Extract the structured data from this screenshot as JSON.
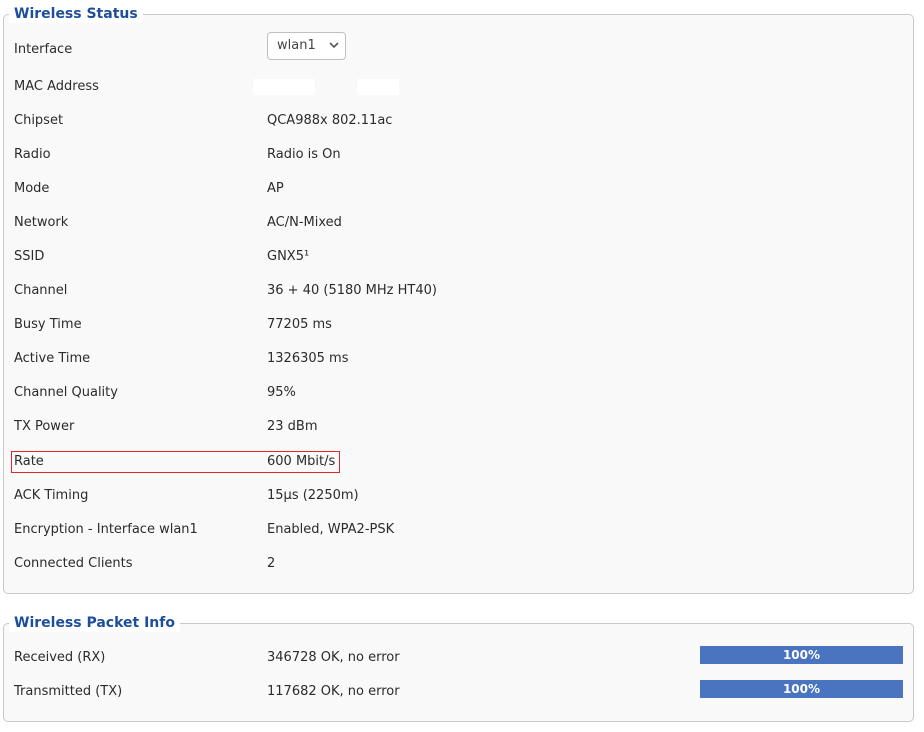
{
  "wireless_status": {
    "title": "Wireless Status",
    "interface": {
      "label": "Interface",
      "selected": "wlan1"
    },
    "mac_address": {
      "label": "MAC Address"
    },
    "chipset": {
      "label": "Chipset",
      "value": "QCA988x 802.11ac"
    },
    "radio": {
      "label": "Radio",
      "value": "Radio is On"
    },
    "mode": {
      "label": "Mode",
      "value": "AP"
    },
    "network": {
      "label": "Network",
      "value": "AC/N-Mixed"
    },
    "ssid": {
      "label": "SSID",
      "value": "GNX5¹"
    },
    "channel": {
      "label": "Channel",
      "value": "36 + 40 (5180 MHz HT40)"
    },
    "busy_time": {
      "label": "Busy Time",
      "value": "77205 ms"
    },
    "active_time": {
      "label": "Active Time",
      "value": "1326305 ms"
    },
    "channel_quality": {
      "label": "Channel Quality",
      "value": "95%"
    },
    "tx_power": {
      "label": "TX Power",
      "value": "23 dBm"
    },
    "rate": {
      "label": "Rate",
      "value": "600 Mbit/s"
    },
    "ack_timing": {
      "label": "ACK Timing",
      "value": "15μs (2250m)"
    },
    "encryption": {
      "label": "Encryption - Interface wlan1",
      "value": "Enabled, WPA2-PSK"
    },
    "connected_clients": {
      "label": "Connected Clients",
      "value": "2"
    }
  },
  "packet_info": {
    "title": "Wireless Packet Info",
    "rx": {
      "label": "Received (RX)",
      "value": "346728 OK, no error",
      "bar_text": "100%",
      "fill_fraction": 1.0
    },
    "tx": {
      "label": "Transmitted (TX)",
      "value": "117682 OK, no error",
      "bar_text": "100%",
      "fill_fraction": 1.0
    }
  },
  "colors": {
    "legend_title": "#1d4e9a",
    "bar_fill": "#4a73c0",
    "highlight_border": "#d9292f"
  }
}
